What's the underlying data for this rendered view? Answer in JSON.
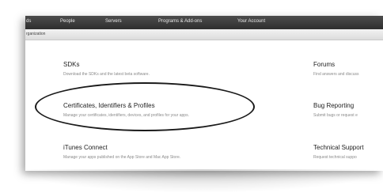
{
  "nav": {
    "items": [
      "ds",
      "People",
      "Servers",
      "Programs & Add-ons",
      "Your Account"
    ]
  },
  "subbar": {
    "label": "rganization"
  },
  "sections": {
    "sdks": {
      "title": "SDKs",
      "desc": "Download the SDKs and the latest beta software."
    },
    "certs": {
      "title": "Certificates, Identifiers & Profiles",
      "desc": "Manage your certificates, identifiers, devices, and profiles for your apps."
    },
    "itunes": {
      "title": "iTunes Connect",
      "desc": "Manage your apps published on the App Store and Mac App Store."
    },
    "forums": {
      "title": "Forums",
      "desc": "Find answers and discuss"
    },
    "bug": {
      "title": "Bug Reporting",
      "desc": "Submit bugs or request e"
    },
    "support": {
      "title": "Technical Support",
      "desc": "Request technical suppo"
    }
  },
  "highlight": {
    "shape": "hand-drawn-ellipse",
    "target": "certs",
    "color": "#1a1a1a"
  }
}
